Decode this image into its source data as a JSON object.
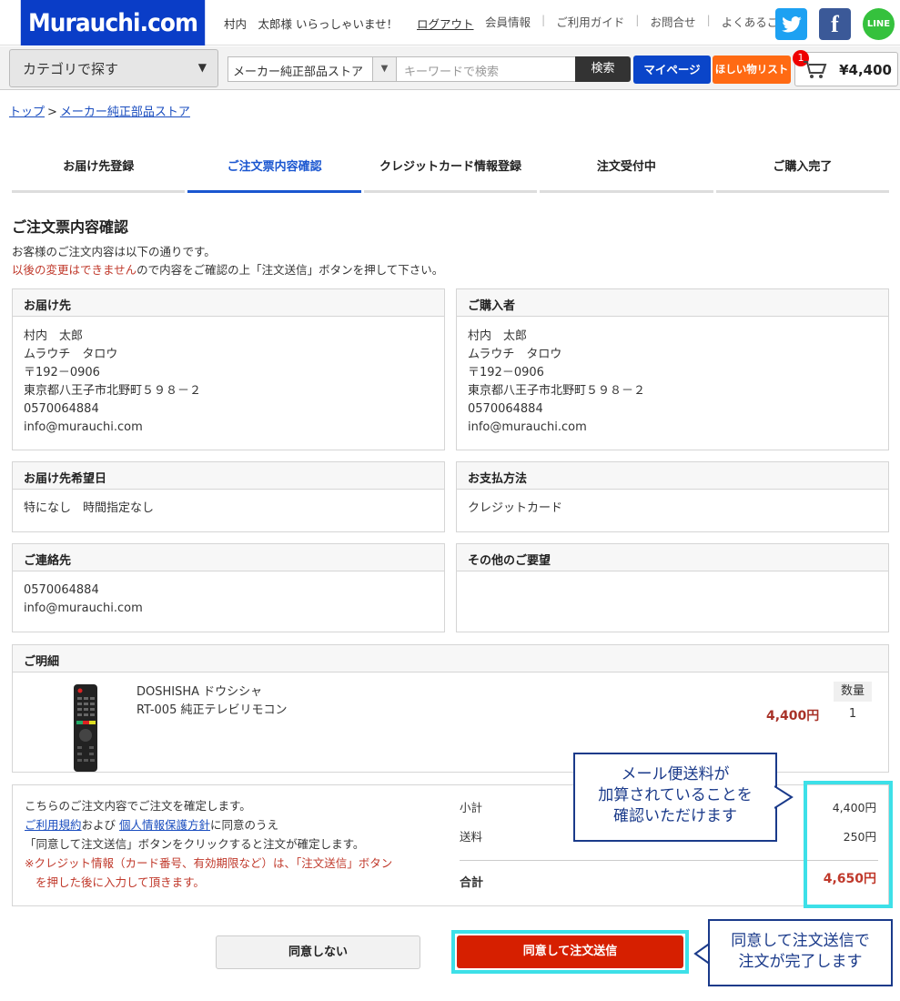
{
  "header": {
    "logo": "Murauchi.com",
    "greeting": "村内　太郎様 いらっしゃいませ！",
    "logout": "ログアウト",
    "links": [
      "会員情報",
      "ご利用ガイド",
      "お問合せ",
      "よくあるご質問"
    ],
    "social": {
      "twitter": "twitter-icon",
      "facebook": "facebook-icon",
      "line": "line-icon"
    },
    "line_label": "LINE",
    "facebook_glyph": "f"
  },
  "nav": {
    "category_label": "カテゴリで探す",
    "store_select": "メーカー純正部品ストア",
    "keyword_placeholder": "キーワードで検索",
    "search_label": "検索",
    "mypage_label": "マイページ",
    "wishlist_label": "ほしい物リスト",
    "cart_count": "1",
    "cart_total": "¥4,400"
  },
  "breadcrumb": {
    "top": "トップ",
    "sep": ">",
    "current": "メーカー純正部品ストア"
  },
  "steps": [
    {
      "label": "お届け先登録"
    },
    {
      "label": "ご注文票内容確認"
    },
    {
      "label": "クレジットカード情報登録"
    },
    {
      "label": "注文受付中"
    },
    {
      "label": "ご購入完了"
    }
  ],
  "page": {
    "title": "ご注文票内容確認",
    "intro1": "お客様のご注文内容は以下の通りです。",
    "intro2_red": "以後の変更はできません",
    "intro2_rest": "ので内容をご確認の上「注文送信」ボタンを押して下さい。"
  },
  "delivery": {
    "header": "お届け先",
    "lines": [
      "村内　太郎",
      "ムラウチ　タロウ",
      "〒192－0906",
      "東京都八王子市北野町５９８－２",
      "0570064884",
      "info@murauchi.com"
    ]
  },
  "purchaser": {
    "header": "ご購入者",
    "lines": [
      "村内　太郎",
      "ムラウチ　タロウ",
      "〒192－0906",
      "東京都八王子市北野町５９８－２",
      "0570064884",
      "info@murauchi.com"
    ]
  },
  "delivery_date": {
    "header": "お届け先希望日",
    "value": "特になし　時間指定なし"
  },
  "payment": {
    "header": "お支払方法",
    "value": "クレジットカード"
  },
  "contact": {
    "header": "ご連絡先",
    "lines": [
      "0570064884",
      "info@murauchi.com"
    ]
  },
  "requests": {
    "header": "その他のご要望"
  },
  "details": {
    "header": "ご明細",
    "product_line1": "DOSHISHA ドウシシャ",
    "product_line2": "RT-005 純正テレビリモコン",
    "price": "4,400円",
    "qty_header": "数量",
    "qty": "1"
  },
  "summary": {
    "line1": "こちらのご注文内容でご注文を確定します。",
    "terms_link": "ご利用規約",
    "and": "および",
    "privacy_link": "個人情報保護方針",
    "agree_tail": "に同意のうえ",
    "line3": "「同意して注文送信」ボタンをクリックすると注文が確定します。",
    "note1": "※クレジット情報（カード番号、有効期限など）は、「注文送信」ボタン",
    "note2": "を押した後に入力して頂きます。",
    "subtotal_label": "小計",
    "subtotal": "4,400円",
    "shipping_label": "送料",
    "shipping": "250円",
    "total_label": "合計",
    "total": "4,650円"
  },
  "callouts": {
    "shipping_note": [
      "メール便送料が",
      "加算されていることを",
      "確認いただけます"
    ],
    "submit_note": [
      "同意して注文送信で",
      "注文が完了します"
    ]
  },
  "buttons": {
    "disagree": "同意しない",
    "agree": "同意して注文送信"
  },
  "colors": {
    "brand": "#0a3dc7",
    "accent": "#1a56d0",
    "submit": "#d61f00",
    "price": "#a83228",
    "highlight": "#3de0e8",
    "wishlist": "#ff6a13"
  }
}
